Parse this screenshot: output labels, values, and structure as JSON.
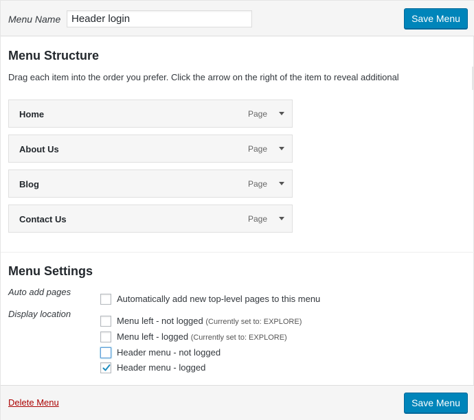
{
  "header": {
    "menu_name_label": "Menu Name",
    "menu_name_value": "Header login",
    "save_label": "Save Menu"
  },
  "structure": {
    "title": "Menu Structure",
    "instructions": "Drag each item into the order you prefer. Click the arrow on the right of the item to reveal additional",
    "items": [
      {
        "label": "Home",
        "type": "Page"
      },
      {
        "label": "About Us",
        "type": "Page"
      },
      {
        "label": "Blog",
        "type": "Page"
      },
      {
        "label": "Contact Us",
        "type": "Page"
      }
    ]
  },
  "settings": {
    "title": "Menu Settings",
    "auto_add_label": "Auto add pages",
    "auto_add_option": "Automatically add new top-level pages to this menu",
    "display_label": "Display location",
    "locations": [
      {
        "label": "Menu left - not logged",
        "note": "(Currently set to: EXPLORE)",
        "checked": false
      },
      {
        "label": "Menu left - logged",
        "note": "(Currently set to: EXPLORE)",
        "checked": false
      },
      {
        "label": "Header menu - not logged",
        "note": "",
        "checked": false
      },
      {
        "label": "Header menu - logged",
        "note": "",
        "checked": true
      }
    ]
  },
  "footer": {
    "delete_label": "Delete Menu",
    "save_label": "Save Menu"
  },
  "colors": {
    "primary": "#0085ba",
    "delete": "#aa0000",
    "check": "#1e8cbe"
  },
  "icons": {
    "item_toggle": "arrow-down-icon",
    "checked": "checkmark-icon"
  }
}
